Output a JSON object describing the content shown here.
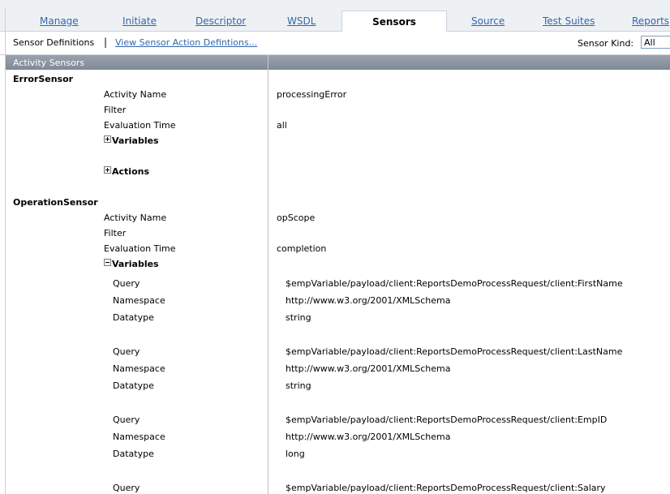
{
  "tabs": [
    {
      "label": "Manage",
      "active": false
    },
    {
      "label": "Initiate",
      "active": false
    },
    {
      "label": "Descriptor",
      "active": false
    },
    {
      "label": "WSDL",
      "active": false
    },
    {
      "label": "Sensors",
      "active": true
    },
    {
      "label": "Source",
      "active": false
    },
    {
      "label": "Test Suites",
      "active": false
    },
    {
      "label": "Reports",
      "active": false
    }
  ],
  "toolbar": {
    "sensor_definitions_label": "Sensor Definitions",
    "separator": "|",
    "view_actions_link": "View Sensor Action Defintions...",
    "sensor_kind_label": "Sensor Kind:",
    "sensor_kind_value": "All"
  },
  "table": {
    "header_label": "Activity Sensors"
  },
  "sensors": [
    {
      "name": "ErrorSensor",
      "activity_name_label": "Activity Name",
      "activity_name": "processingError",
      "filter_label": "Filter",
      "filter": "",
      "evaluation_time_label": "Evaluation Time",
      "evaluation_time": "all",
      "variables_label": "Variables",
      "variables_expanded": false,
      "actions_label": "Actions",
      "actions_expanded": false
    },
    {
      "name": "OperationSensor",
      "activity_name_label": "Activity Name",
      "activity_name": "opScope",
      "filter_label": "Filter",
      "filter": "",
      "evaluation_time_label": "Evaluation Time",
      "evaluation_time": "completion",
      "variables_label": "Variables",
      "variables_expanded": true,
      "variables": [
        {
          "query_label": "Query",
          "query": "$empVariable/payload/client:ReportsDemoProcessRequest/client:FirstName",
          "namespace_label": "Namespace",
          "namespace": "http://www.w3.org/2001/XMLSchema",
          "datatype_label": "Datatype",
          "datatype": "string"
        },
        {
          "query_label": "Query",
          "query": "$empVariable/payload/client:ReportsDemoProcessRequest/client:LastName",
          "namespace_label": "Namespace",
          "namespace": "http://www.w3.org/2001/XMLSchema",
          "datatype_label": "Datatype",
          "datatype": "string"
        },
        {
          "query_label": "Query",
          "query": "$empVariable/payload/client:ReportsDemoProcessRequest/client:EmpID",
          "namespace_label": "Namespace",
          "namespace": "http://www.w3.org/2001/XMLSchema",
          "datatype_label": "Datatype",
          "datatype": "long"
        },
        {
          "query_label": "Query",
          "query": "$empVariable/payload/client:ReportsDemoProcessRequest/client:Salary"
        }
      ]
    }
  ]
}
